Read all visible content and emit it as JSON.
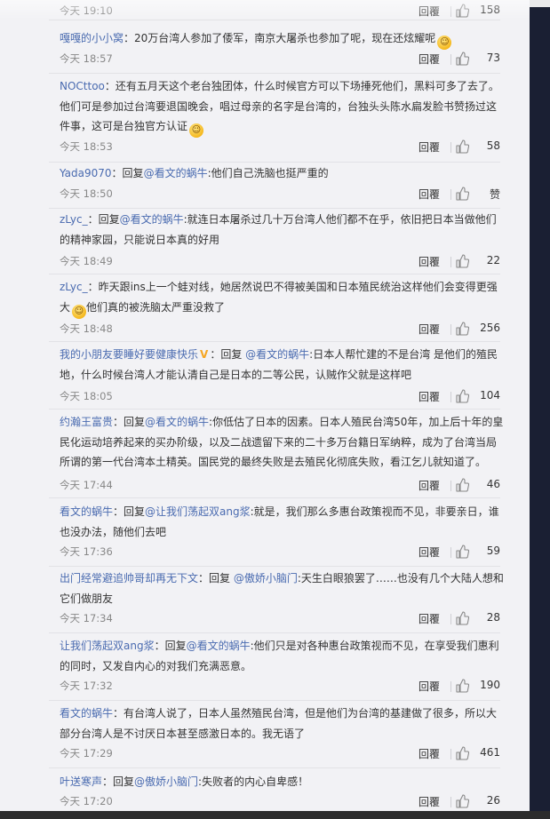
{
  "reply_label": "回覆",
  "comments": [
    {
      "name": "",
      "text": "",
      "mention": "",
      "rest": "",
      "time": "今天 19:10",
      "likes": "158"
    },
    {
      "name": "嘎嘎的小小窝",
      "text": "：20万台湾人参加了倭军，南京大屠杀也参加了呢，现在还炫耀呢",
      "emoji": "smile-emoji",
      "time": "今天 18:57",
      "likes": "73"
    },
    {
      "name": "NOCttoo",
      "text": "：还有五月天这个老台独团体，什么时候官方可以下场捶死他们，黑料可多了去了。他们可是参加过台湾要退国晚会，唱过母亲的名字是台湾的，台独头头陈水扁发脸书赞扬过这件事，这可是台独官方认证",
      "emoji": "sweat-emoji",
      "time": "今天 18:53",
      "likes": "58"
    },
    {
      "name": "Yada9070",
      "text": "：回复",
      "mention": "@看文的蜗牛",
      "rest": ":他们自己洗脑也挺严重的",
      "time": "今天 18:50",
      "likes": "赞"
    },
    {
      "name": "zLyc_",
      "text": "：回复",
      "mention": "@看文的蜗牛",
      "rest": ":就连日本屠杀过几十万台湾人他们都不在乎，依旧把日本当做他们的精神家园，只能说日本真的好用",
      "time": "今天 18:49",
      "likes": "22"
    },
    {
      "name": "zLyc_",
      "text": "：昨天跟ins上一个蛙对线，她居然说巴不得被美国和日本殖民统治这样他们会变得更强大",
      "emoji": "laugh-emoji",
      "rest": "他们真的被洗脑太严重没救了",
      "time": "今天 18:48",
      "likes": "256"
    },
    {
      "name": "我的小朋友要睡好要健康快乐",
      "badge": "V",
      "text": "：回复 ",
      "mention": "@看文的蜗牛",
      "rest": ":日本人帮忙建的不是台湾 是他们的殖民地，什么时候台湾人才能认清自己是日本的二等公民，认贼作父就是这样吧",
      "time": "今天 18:05",
      "likes": "104"
    },
    {
      "name": "约瀚王富贵",
      "text": "：回复",
      "mention": "@看文的蜗牛",
      "rest": ":你低估了日本的因素。日本人殖民台湾50年，加上后十年的皇民化运动培养起来的买办阶级，以及二战遗留下来的二十多万台籍日军纳粹，成为了台湾当局所谓的第一代台湾本土精英。国民党的最终失败是去殖民化彻底失败，看江乞儿就知道了。",
      "time": "今天 17:44",
      "likes": "46"
    },
    {
      "name": "看文的蜗牛",
      "text": "：回复",
      "mention": "@让我们荡起双ang浆",
      "rest": ":就是，我们那么多惠台政策视而不见，非要亲日，谁也没办法，随他们去吧",
      "time": "今天 17:36",
      "likes": "59"
    },
    {
      "name": "出门经常避追帅哥却再无下文",
      "text": "：回复 ",
      "mention": "@傲娇小脑门",
      "rest": ":天生白眼狼罢了……也没有几个大陆人想和它们做朋友",
      "time": "今天 17:34",
      "likes": "28"
    },
    {
      "name": "让我们荡起双ang浆",
      "text": "：回复",
      "mention": "@看文的蜗牛",
      "rest": ":他们只是对各种惠台政策视而不见，在享受我们惠利的同时，又发自内心的对我们充满恶意。",
      "time": "今天 17:32",
      "likes": "190"
    },
    {
      "name": "看文的蜗牛",
      "text": "：有台湾人说了，日本人虽然殖民台湾，但是他们为台湾的基建做了很多，所以大部分台湾人是不讨厌日本甚至感激日本的。我无语了",
      "time": "今天 17:29",
      "likes": "461"
    },
    {
      "name": "叶送寒声",
      "text": "：回复",
      "mention": "@傲娇小脑门",
      "rest": ":失败者的内心自卑感！",
      "time": "今天 17:20",
      "likes": "26"
    }
  ]
}
